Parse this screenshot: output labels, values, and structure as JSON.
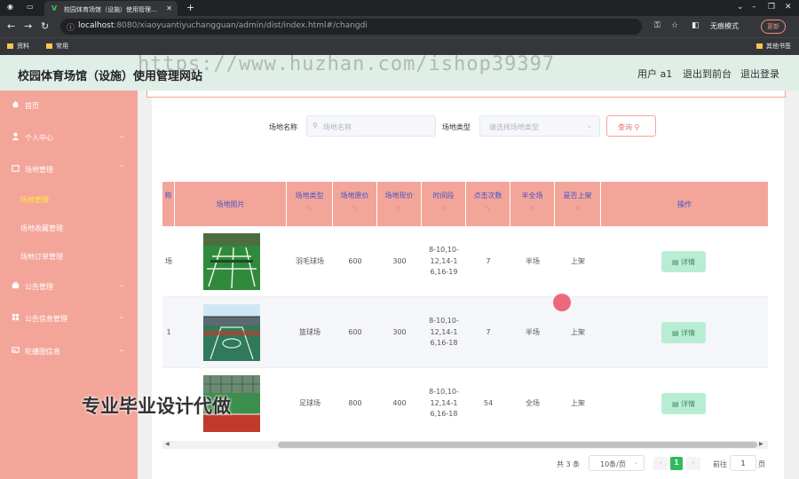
{
  "browser": {
    "tab_title": "校园体育场馆（设施）使用管理…",
    "url_host": "localhost",
    "url_path": ":8080/xiaoyuantiyuchangguan/admin/dist/index.html#/changdi",
    "incognito_label": "无痕模式",
    "update_label": "更新",
    "bookmarks": [
      "资料",
      "常用"
    ],
    "other_bookmarks": "其他书签"
  },
  "header": {
    "title": "校园体育场馆（设施）使用管理网站",
    "user": "用户 a1",
    "back_front": "退出到前台",
    "logout": "退出登录",
    "watermark": "https://www.huzhan.com/ishop39397"
  },
  "sidebar": {
    "items": [
      {
        "label": "首页",
        "icon": "home-icon"
      },
      {
        "label": "个人中心",
        "icon": "user-icon"
      },
      {
        "label": "场地管理",
        "icon": "folder-icon"
      },
      {
        "label": "公告管理",
        "icon": "briefcase-icon"
      },
      {
        "label": "公告信息管理",
        "icon": "grid-icon"
      },
      {
        "label": "轮播图信息",
        "icon": "image-icon"
      }
    ],
    "sub_items": [
      {
        "label": "场地管理",
        "active": true
      },
      {
        "label": "场地收藏管理",
        "active": false
      },
      {
        "label": "场地订单管理",
        "active": false
      }
    ],
    "promo": "专业毕业设计代做"
  },
  "search": {
    "name_label": "场地名称",
    "name_placeholder": "场地名称",
    "type_label": "场地类型",
    "type_placeholder": "请选择场地类型",
    "query_label": "查询"
  },
  "table": {
    "columns": [
      "称",
      "场地照片",
      "场地类型",
      "场地原价",
      "场地现价",
      "时间段",
      "点击次数",
      "半全场",
      "是否上架",
      "操作"
    ],
    "rows": [
      {
        "name": "场",
        "type": "羽毛球场",
        "orig": "600",
        "now": "300",
        "time": "8-10,10-\n12,14-1\n6,16-19",
        "clicks": "7",
        "half": "半场",
        "shelf": "上架",
        "photo": "badminton"
      },
      {
        "name": "1",
        "type": "篮球场",
        "orig": "600",
        "now": "300",
        "time": "8-10,10-\n12,14-1\n6,16-18",
        "clicks": "7",
        "half": "半场",
        "shelf": "上架",
        "photo": "basketball"
      },
      {
        "name": "",
        "type": "足球场",
        "orig": "800",
        "now": "400",
        "time": "8-10,10-\n12,14-1\n6,16-18",
        "clicks": "54",
        "half": "全场",
        "shelf": "上架",
        "photo": "football"
      }
    ],
    "detail_label": "详情"
  },
  "pagination": {
    "total": "共 3 条",
    "page_size": "10条/页",
    "current": "1",
    "goto_label": "前往",
    "goto_value": "1",
    "page_suffix": "页"
  },
  "colors": {
    "sidebar": "#f4a59a",
    "header": "#dfeee6",
    "accent_green": "#2fba5f",
    "header_text": "#4353c8"
  }
}
